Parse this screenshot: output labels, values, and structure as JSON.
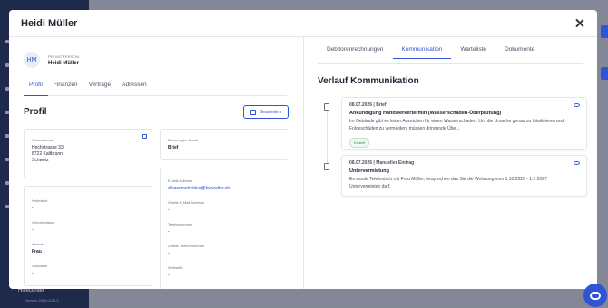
{
  "app": {
    "sidebar_label": "Hilfecenter",
    "sidebar_version": "Version 2026.0101.0"
  },
  "modal": {
    "title": "Heidi Müller"
  },
  "person": {
    "avatar_initials": "HM",
    "role": "PRIVATPERSON",
    "name": "Heidi Müller"
  },
  "left_tabs": [
    {
      "label": "Profil",
      "active": true
    },
    {
      "label": "Finanzen",
      "active": false
    },
    {
      "label": "Verträge",
      "active": false
    },
    {
      "label": "Adressen",
      "active": false
    }
  ],
  "profile": {
    "title": "Profil",
    "edit_label": "Bearbeiten",
    "address": {
      "label": "Wohnadresse",
      "line1": "Hochstrasse 33",
      "line2": "8722 Kaltbrunn",
      "line3": "Schweiz"
    },
    "channel": {
      "label": "Bevorzugter Kanal",
      "value": "Brief"
    },
    "contact": {
      "email_label": "E-Mail-Adresse",
      "email_value": "dinarzimohvideo@fairwalter.ch",
      "email2_label": "Zweite E-Mail-Adresse",
      "email2_value": "-",
      "phone_label": "Telefonnummer",
      "phone_value": "-",
      "phone2_label": "Zweite Telefonnummer",
      "phone2_value": "-",
      "website_label": "Webseite",
      "website_value": "-"
    },
    "personal": {
      "hometown_label": "Heimatort",
      "hometown_value": "-",
      "birth_label": "Geburtsdatum",
      "birth_value": "-",
      "salutation_label": "Anrede",
      "salutation_value": "Frau",
      "civil_label": "Zivilstand",
      "civil_value": "-"
    }
  },
  "right_tabs": [
    {
      "label": "Debitorenrechnungen",
      "active": false
    },
    {
      "label": "Kommunikation",
      "active": true
    },
    {
      "label": "Warteliste",
      "active": false
    },
    {
      "label": "Dokumente",
      "active": false
    }
  ],
  "history": {
    "title": "Verlauf Kommunikation",
    "entries": [
      {
        "head": "08.07.2026 | Brief",
        "title": "Ankündigung Handwerkertermin (Wasserschaden-Überprüfung)",
        "text": "Im Gebäude gibt es leider Anzeichen für einen Wasserschaden. Um die Ursache genau zu lokalisieren und Folgeschäden zu vermeiden, müssen dringende Übe...",
        "badge": "Erstellt"
      },
      {
        "head": "08.07.2026 | Manueller Eintrag",
        "title": "Untervermietung",
        "text": "Es wurde Telefonisch mit Frau Müller, besprochen das Sie die Wohnung vom 1.10.2026 - 1.2.2027 Untervermieten darf.",
        "badge": ""
      }
    ]
  },
  "colors": {
    "accent": "#2f55d4",
    "sidebar": "#1f2a4b",
    "success": "#2e8b4a"
  }
}
